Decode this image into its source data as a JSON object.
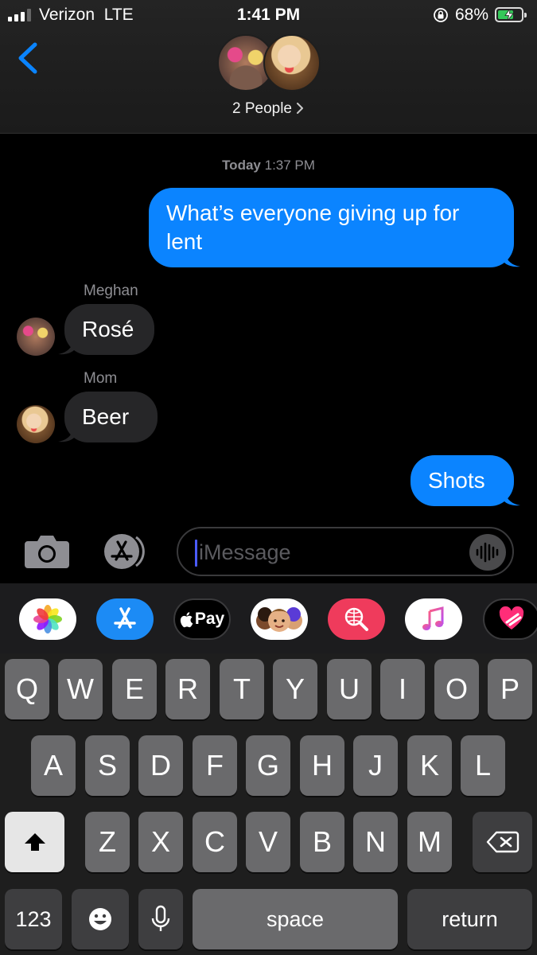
{
  "status_bar": {
    "carrier": "Verizon",
    "network": "LTE",
    "time": "1:41 PM",
    "battery_percent": "68%",
    "battery_level": 0.68,
    "signal_bars": 3,
    "icons": [
      "cellular-signal-icon",
      "orientation-lock-icon",
      "battery-charging-icon"
    ]
  },
  "header": {
    "group_label": "2 People",
    "participants": [
      "Meghan",
      "Mom"
    ],
    "icons": [
      "back-chevron-icon",
      "chevron-right-icon"
    ]
  },
  "conversation": {
    "timestamp_day": "Today",
    "timestamp_time": "1:37 PM",
    "messages": [
      {
        "sender": "me",
        "text": "What’s everyone giving up for lent"
      },
      {
        "sender": "Meghan",
        "text": "Rosé"
      },
      {
        "sender": "Mom",
        "text": "Beer"
      },
      {
        "sender": "me",
        "text": "Shots"
      }
    ]
  },
  "composer": {
    "placeholder": "iMessage",
    "value": "",
    "icons": [
      "camera-icon",
      "app-store-icon",
      "audio-waveform-icon"
    ]
  },
  "app_drawer": {
    "apps": [
      "Photos",
      "App Store",
      "Apple Pay",
      "Memoji",
      "Images Search",
      "Music",
      "Digital Touch"
    ],
    "apple_pay_label": "Pay"
  },
  "keyboard": {
    "row1": [
      "Q",
      "W",
      "E",
      "R",
      "T",
      "Y",
      "U",
      "I",
      "O",
      "P"
    ],
    "row2": [
      "A",
      "S",
      "D",
      "F",
      "G",
      "H",
      "J",
      "K",
      "L"
    ],
    "row3": [
      "Z",
      "X",
      "C",
      "V",
      "B",
      "N",
      "M"
    ],
    "numbers_label": "123",
    "space_label": "space",
    "return_label": "return",
    "icons": [
      "shift-icon",
      "delete-icon",
      "emoji-icon",
      "microphone-icon"
    ]
  },
  "colors": {
    "outgoing_bubble": "#0b84ff",
    "incoming_bubble": "#262628",
    "accent": "#0a84ff",
    "keyboard_key": "#6a6a6c",
    "battery_fill": "#34c759"
  }
}
